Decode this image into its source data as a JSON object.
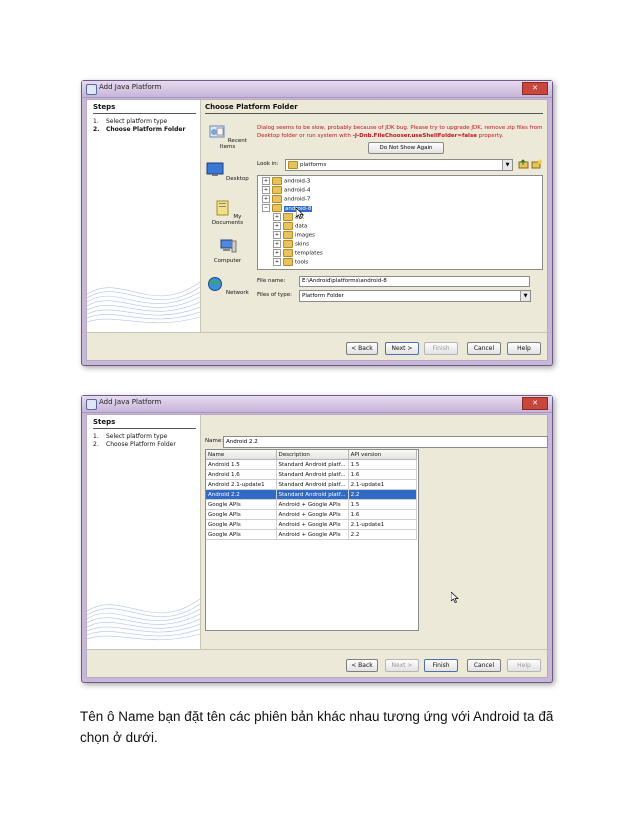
{
  "dialog1": {
    "window_title": "Add Java Platform",
    "steps_title": "Steps",
    "steps": [
      {
        "num": "1.",
        "label": "Select platform type"
      },
      {
        "num": "2.",
        "label": "Choose Platform Folder"
      }
    ],
    "content_title": "Choose Platform Folder",
    "places": [
      "Recent Items",
      "Desktop",
      "My Documents",
      "Computer",
      "Network"
    ],
    "warning_line1": "Dialog seems to be slow, probably because of JDK bug. Please try to upgrade JDK, remove zip files from",
    "warning_line2_prefix": "Desktop folder or run system with",
    "warning_line2_bold": "-J-Dnb.FileChooser.useShellFolder=false",
    "warning_line2_suffix": "property.",
    "dont_show_button": "Do Not Show Again",
    "look_in_label": "Look in:",
    "look_in_value": "platforms",
    "tree": {
      "top": [
        "android-3",
        "android-4",
        "android-7"
      ],
      "selected": "android-8",
      "children": [
        "ant",
        "data",
        "images",
        "skins",
        "templates",
        "tools"
      ]
    },
    "file_name_label": "File name:",
    "file_name_value": "E:\\Android\\platforms\\android-8",
    "files_of_type_label": "Files of type:",
    "files_of_type_value": "Platform Folder",
    "buttons": {
      "back": "< Back",
      "next": "Next >",
      "finish": "Finish",
      "cancel": "Cancel",
      "help": "Help"
    }
  },
  "dialog2": {
    "window_title": "Add Java Platform",
    "steps_title": "Steps",
    "steps": [
      {
        "num": "1.",
        "label": "Select platform type"
      },
      {
        "num": "2.",
        "label": "Choose Platform Folder"
      }
    ],
    "name_label": "Name:",
    "name_value": "Android 2.2",
    "table_headers": [
      "Name",
      "Description",
      "API version"
    ],
    "table_rows": [
      [
        "Android 1.5",
        "Standard Android platf...",
        "1.5"
      ],
      [
        "Android 1.6",
        "Standard Android platf...",
        "1.6"
      ],
      [
        "Android 2.1-update1",
        "Standard Android platf...",
        "2.1-update1"
      ],
      [
        "Android 2.2",
        "Standard Android platf...",
        "2.2"
      ],
      [
        "Google APIs",
        "Android + Google APIs",
        "1.5"
      ],
      [
        "Google APIs",
        "Android + Google APIs",
        "1.6"
      ],
      [
        "Google APIs",
        "Android + Google APIs",
        "2.1-update1"
      ],
      [
        "Google APIs",
        "Android + Google APIs",
        "2.2"
      ]
    ],
    "selected_row": 3,
    "buttons": {
      "back": "< Back",
      "next": "Next >",
      "finish": "Finish",
      "cancel": "Cancel",
      "help": "Help"
    }
  },
  "caption": "Tên ô Name bạn đặt tên các phiên bản khác nhau tương ứng với Android ta đã chọn ở dưới.",
  "colors": {
    "selection": "#316ac5",
    "warning": "#c4111a",
    "frame": "#c9b7d9"
  }
}
